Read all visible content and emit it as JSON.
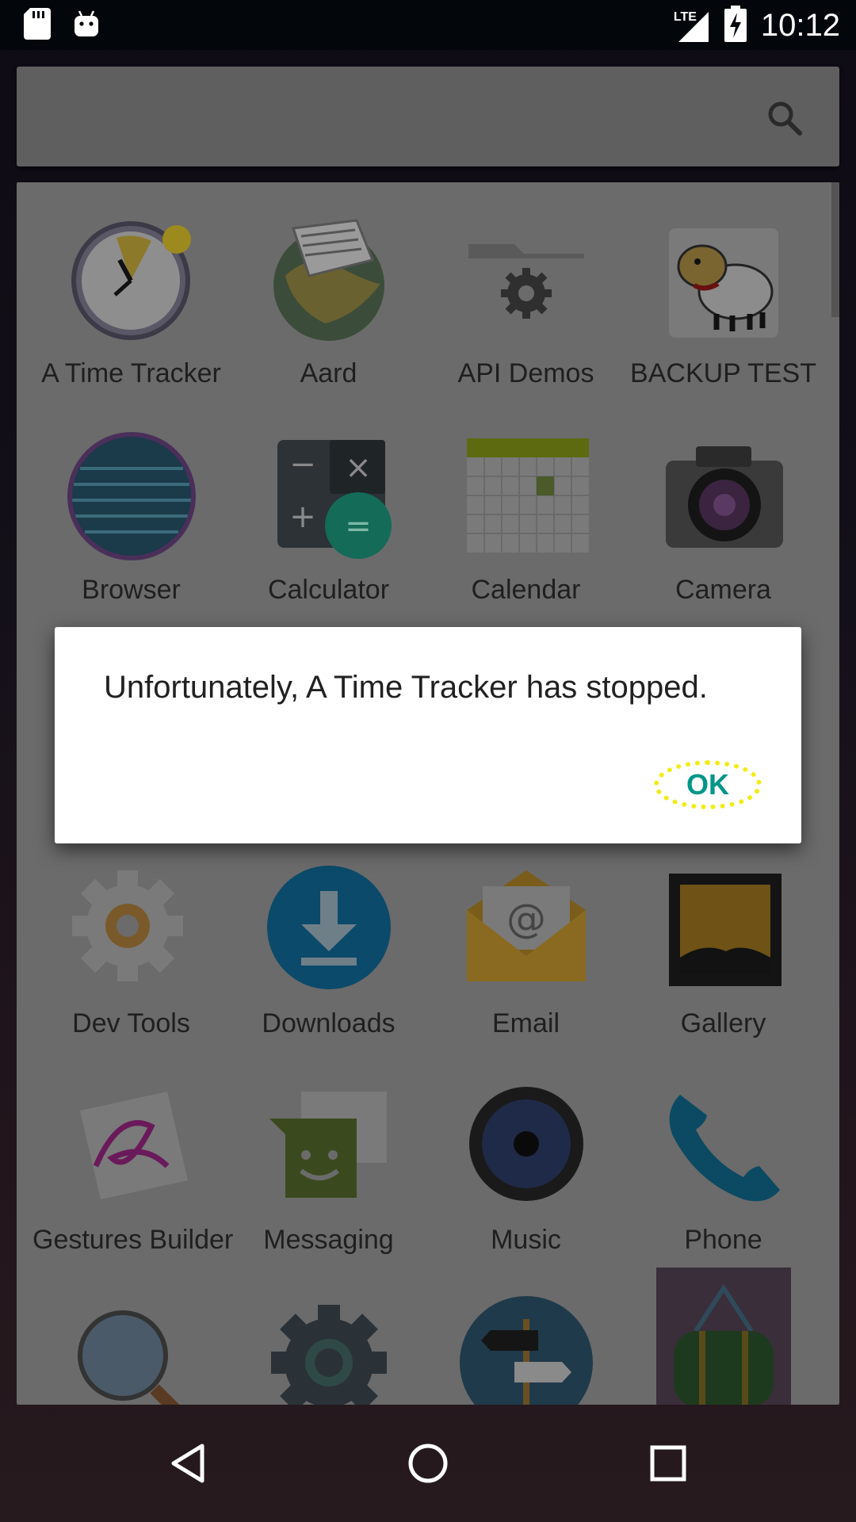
{
  "status_bar": {
    "time": "10:12",
    "network": "LTE",
    "icons": [
      "sd-card-icon",
      "android-icon",
      "lte-signal-icon",
      "battery-charging-icon"
    ]
  },
  "search": {
    "placeholder": ""
  },
  "apps": [
    {
      "label": "A Time Tracker",
      "icon": "clock-icon"
    },
    {
      "label": "Aard",
      "icon": "aard-globe-icon"
    },
    {
      "label": "API Demos",
      "icon": "folder-gear-icon"
    },
    {
      "label": "BACKUP TEST",
      "icon": "sheep-icon"
    },
    {
      "label": "Browser",
      "icon": "globe-icon"
    },
    {
      "label": "Calculator",
      "icon": "calculator-icon"
    },
    {
      "label": "Calendar",
      "icon": "calendar-icon"
    },
    {
      "label": "Camera",
      "icon": "camera-icon"
    },
    {
      "label": "Dev Tools",
      "icon": "gear-icon"
    },
    {
      "label": "Downloads",
      "icon": "download-icon"
    },
    {
      "label": "Email",
      "icon": "email-icon"
    },
    {
      "label": "Gallery",
      "icon": "gallery-icon"
    },
    {
      "label": "Gestures Builder",
      "icon": "gestures-icon"
    },
    {
      "label": "Messaging",
      "icon": "messaging-icon"
    },
    {
      "label": "Music",
      "icon": "speaker-icon"
    },
    {
      "label": "Phone",
      "icon": "phone-icon"
    },
    {
      "label": "",
      "icon": "magnifier-icon"
    },
    {
      "label": "",
      "icon": "settings-icon"
    },
    {
      "label": "",
      "icon": "signpost-icon"
    },
    {
      "label": "",
      "icon": "bag-icon"
    }
  ],
  "dialog": {
    "message": "Unfortunately, A Time Tracker has stopped.",
    "ok_label": "OK"
  },
  "nav": {
    "icons": [
      "back-icon",
      "home-icon",
      "recents-icon"
    ]
  },
  "colors": {
    "accent": "#009688",
    "highlight": "#f2ec17",
    "dim_surface": "#6b6b6b"
  }
}
